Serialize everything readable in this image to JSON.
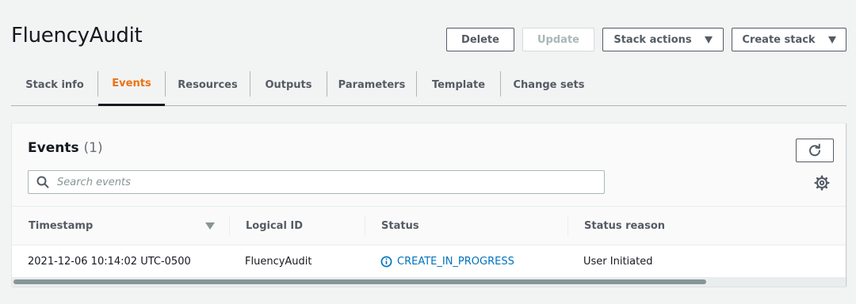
{
  "page": {
    "title": "FluencyAudit"
  },
  "actions": {
    "delete": "Delete",
    "update": "Update",
    "stack_actions": "Stack actions",
    "create_stack": "Create stack"
  },
  "tabs": [
    {
      "label": "Stack info",
      "active": false
    },
    {
      "label": "Events",
      "active": true
    },
    {
      "label": "Resources",
      "active": false
    },
    {
      "label": "Outputs",
      "active": false
    },
    {
      "label": "Parameters",
      "active": false
    },
    {
      "label": "Template",
      "active": false
    },
    {
      "label": "Change sets",
      "active": false
    }
  ],
  "events": {
    "title": "Events",
    "count": "(1)",
    "search": {
      "placeholder": "Search events",
      "value": ""
    },
    "columns": [
      "Timestamp",
      "Logical ID",
      "Status",
      "Status reason"
    ],
    "rows": [
      {
        "timestamp": "2021-12-06 10:14:02 UTC-0500",
        "logical_id": "FluencyAudit",
        "status": "CREATE_IN_PROGRESS",
        "status_reason": "User Initiated"
      }
    ]
  },
  "icons": {
    "refresh": "refresh-icon",
    "settings": "gear-icon",
    "search": "search-icon",
    "status": "info-icon"
  },
  "colors": {
    "accent_tab": "#ec7211",
    "link_blue": "#0073bb",
    "page_bg": "#f2f3f3"
  }
}
